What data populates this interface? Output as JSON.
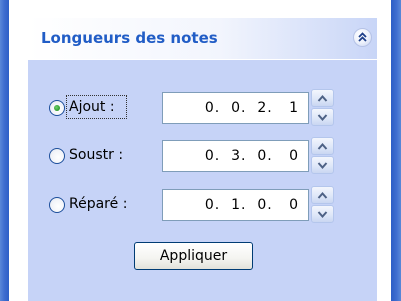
{
  "panel": {
    "title": "Longueurs des notes",
    "collapse_icon": "chevron-double-up-icon"
  },
  "rows": [
    {
      "label": "Ajout :",
      "value": "0.  0.  2.   1",
      "selected": true
    },
    {
      "label": "Soustr :",
      "value": "0.  3.  0.   0",
      "selected": false
    },
    {
      "label": "Réparé :",
      "value": "0.  1.  0.   0",
      "selected": false
    }
  ],
  "apply_button": {
    "label": "Appliquer"
  },
  "colors": {
    "title": "#215dc6",
    "panel_bg": "#c6d3f7",
    "window_border": "#3f6ed0",
    "radio_selected": "#2a9a2a"
  }
}
